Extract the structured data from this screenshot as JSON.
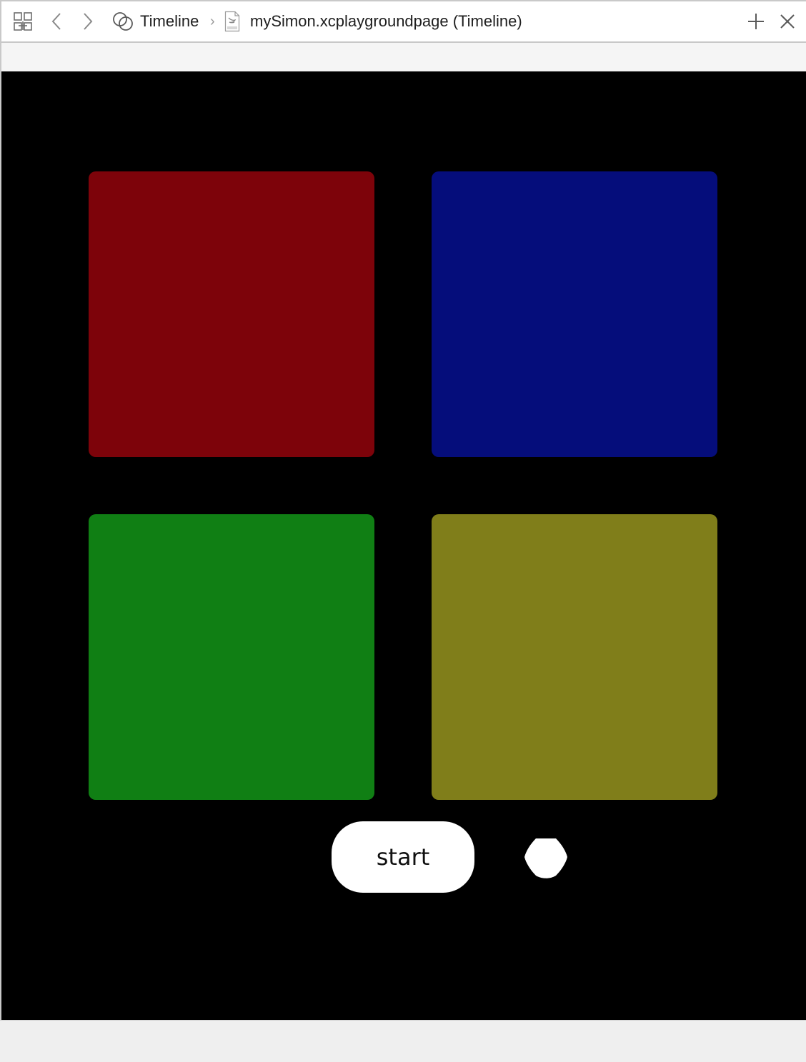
{
  "jumpbar": {
    "related_items_icon": "grid-related-items-icon",
    "back_icon": "chevron-left-icon",
    "forward_icon": "chevron-right-icon",
    "assistant_icon": "overlapping-circles-icon",
    "crumb_1": "Timeline",
    "separator": "›",
    "file_icon": "swift-page-file-icon",
    "crumb_2": "mySimon.xcplaygroundpage (Timeline)",
    "add_icon": "plus-icon",
    "close_icon": "close-icon"
  },
  "game": {
    "pads": [
      {
        "id": "red",
        "color": "#7d030a"
      },
      {
        "id": "blue",
        "color": "#050d7b"
      },
      {
        "id": "green",
        "color": "#107f14"
      },
      {
        "id": "yellow",
        "color": "#807e1a"
      }
    ],
    "start_label": "start",
    "indicator_color": "#ffffff"
  }
}
